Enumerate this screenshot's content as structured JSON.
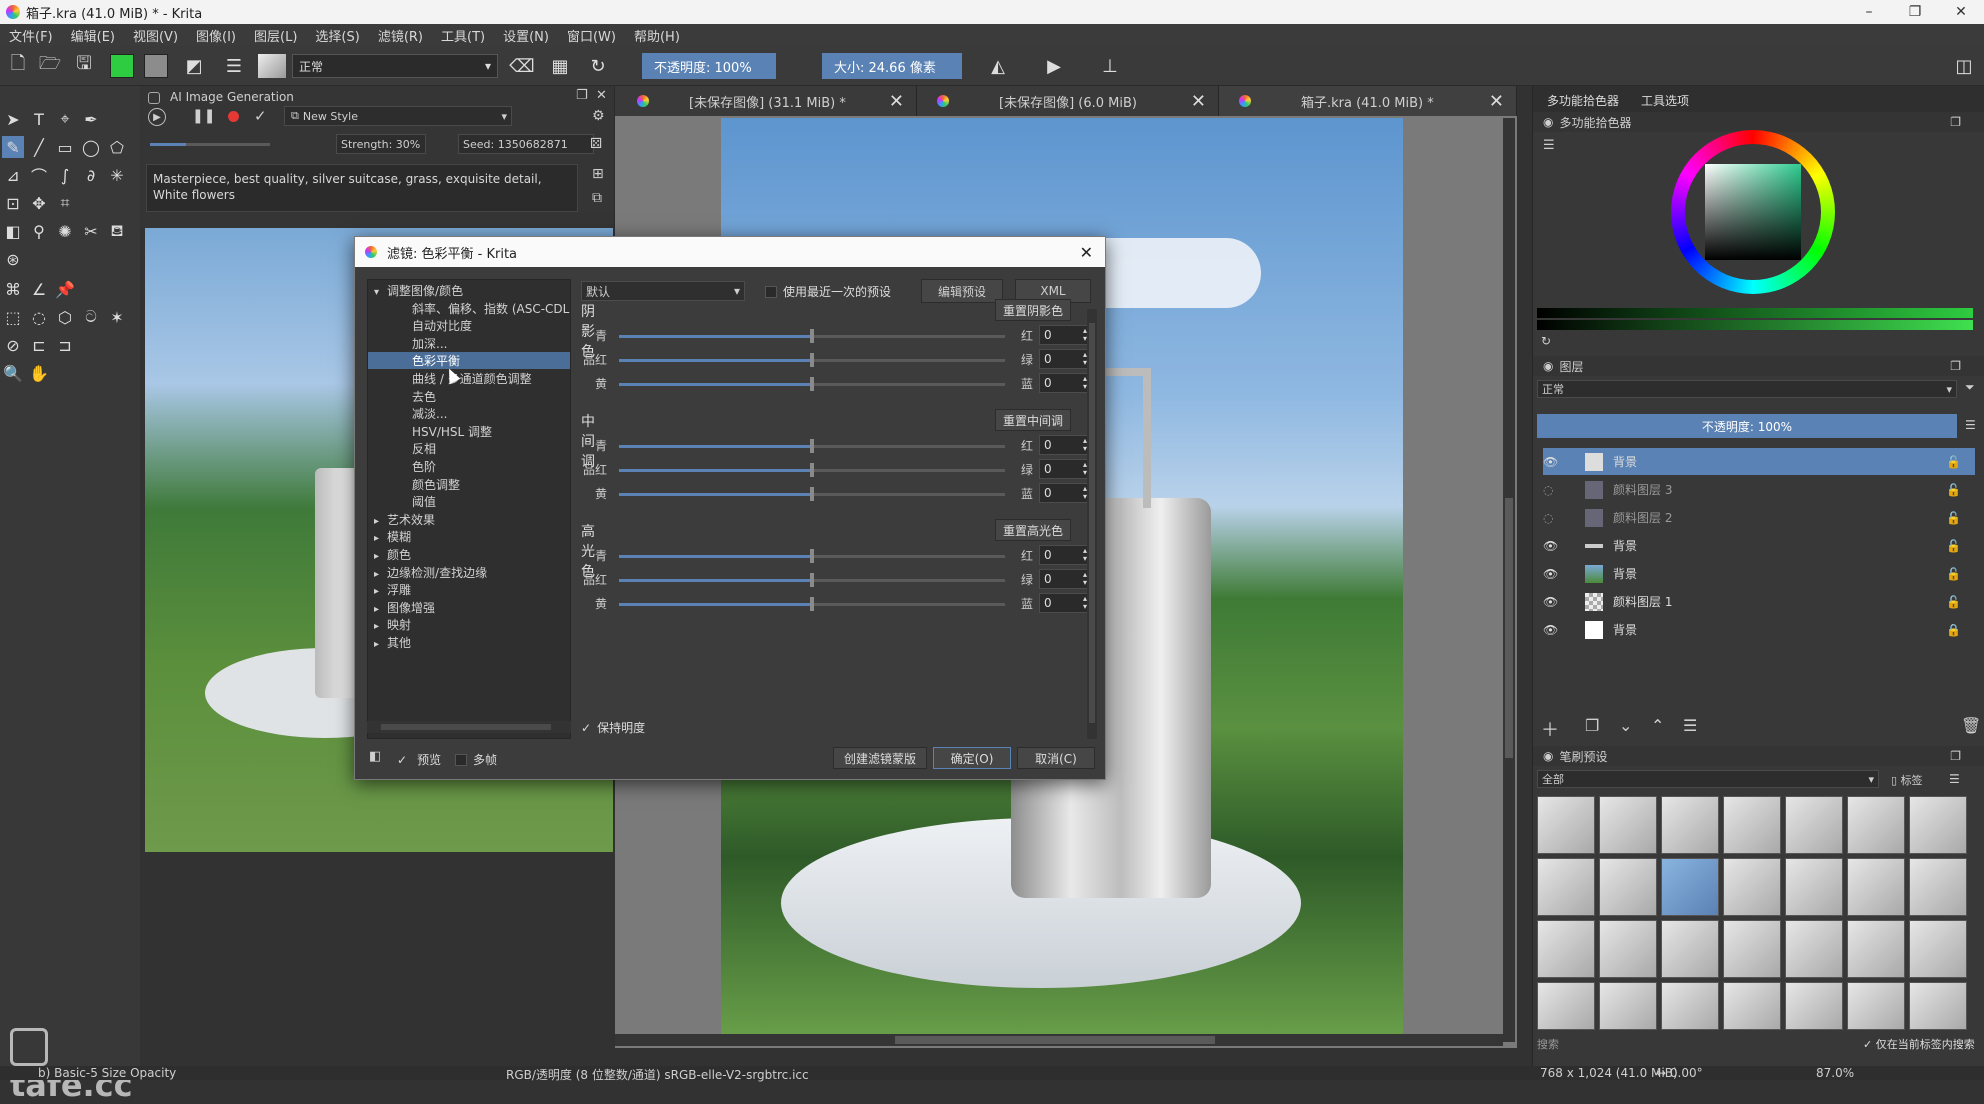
{
  "window": {
    "title": "箱子.kra (41.0 MiB) * - Krita"
  },
  "menu": [
    "文件(F)",
    "编辑(E)",
    "视图(V)",
    "图像(I)",
    "图层(L)",
    "选择(S)",
    "滤镜(R)",
    "工具(T)",
    "设置(N)",
    "窗口(W)",
    "帮助(H)"
  ],
  "toolbar": {
    "blend_mode": "正常",
    "opacity_label": "不透明度: 100%",
    "size_label": "大小: 24.66 像素"
  },
  "ai": {
    "title": "AI Image Generation",
    "style": "New Style",
    "strength": "Strength: 30%",
    "seed": "Seed: 1350682871",
    "prompt": "Masterpiece, best quality, silver suitcase, grass, exquisite detail, White flowers"
  },
  "tabs": [
    {
      "label": "[未保存图像] (31.1 MiB) *"
    },
    {
      "label": "[未保存图像] (6.0 MiB)"
    },
    {
      "label": "箱子.kra (41.0 MiB) *"
    }
  ],
  "right": {
    "tab1": "多功能拾色器",
    "tab2": "工具选项",
    "color_panel_title": "多功能拾色器",
    "layers_title": "图层",
    "layer_mode": "正常",
    "layer_opacity": "不透明度: 100%",
    "layers": [
      "背景",
      "颜料图层 3",
      "颜料图层 2",
      "背景",
      "背景",
      "颜料图层 1",
      "背景"
    ],
    "brush_title": "笔刷预设",
    "brush_filter": "全部",
    "brush_tag": "标签",
    "brush_search": "搜索",
    "brush_tag_only": "仅在当前标签内搜索"
  },
  "dialog": {
    "title": "滤镜: 色彩平衡 - Krita",
    "tree": [
      {
        "label": "调整图像/颜色",
        "level": 0,
        "expanded": true
      },
      {
        "label": "斜率、偏移、指数 (ASC-CDL)",
        "level": 1
      },
      {
        "label": "自动对比度",
        "level": 1
      },
      {
        "label": "加深...",
        "level": 1
      },
      {
        "label": "色彩平衡",
        "level": 1,
        "selected": true
      },
      {
        "label": "曲线 / 多通道颜色调整",
        "level": 1
      },
      {
        "label": "去色",
        "level": 1
      },
      {
        "label": "减淡...",
        "level": 1
      },
      {
        "label": "HSV/HSL 调整",
        "level": 1
      },
      {
        "label": "反相",
        "level": 1
      },
      {
        "label": "色阶",
        "level": 1
      },
      {
        "label": "颜色调整",
        "level": 1
      },
      {
        "label": "阈值",
        "level": 1
      },
      {
        "label": "艺术效果",
        "level": 0
      },
      {
        "label": "模糊",
        "level": 0
      },
      {
        "label": "颜色",
        "level": 0
      },
      {
        "label": "边缘检测/查找边缘",
        "level": 0
      },
      {
        "label": "浮雕",
        "level": 0
      },
      {
        "label": "图像增强",
        "level": 0
      },
      {
        "label": "映射",
        "level": 0
      },
      {
        "label": "其他",
        "level": 0
      }
    ],
    "preset": "默认",
    "use_last_preset": "使用最近一次的预设",
    "edit_preset": "编辑预设",
    "xml": "XML",
    "sections": [
      {
        "title": "阴影色",
        "reset": "重置阴影色",
        "rows": [
          {
            "left": "青",
            "right": "红",
            "value": "0"
          },
          {
            "left": "品红",
            "right": "绿",
            "value": "0"
          },
          {
            "left": "黄",
            "right": "蓝",
            "value": "0"
          }
        ]
      },
      {
        "title": "中间调",
        "reset": "重置中间调",
        "rows": [
          {
            "left": "青",
            "right": "红",
            "value": "0"
          },
          {
            "left": "品红",
            "right": "绿",
            "value": "0"
          },
          {
            "left": "黄",
            "right": "蓝",
            "value": "0"
          }
        ]
      },
      {
        "title": "高光色",
        "reset": "重置高光色",
        "rows": [
          {
            "left": "青",
            "right": "红",
            "value": "0"
          },
          {
            "left": "品红",
            "right": "绿",
            "value": "0"
          },
          {
            "left": "黄",
            "right": "蓝",
            "value": "0"
          }
        ]
      }
    ],
    "preserve_luminosity": "保持明度",
    "preview": "预览",
    "multiframe": "多帧",
    "create_mask": "创建滤镜蒙版",
    "ok": "确定(O)",
    "cancel": "取消(C)"
  },
  "status": {
    "brush": "b) Basic-5 Size Opacity",
    "colorspace": "RGB/透明度 (8 位整数/通道)  sRGB-elle-V2-srgbtrc.icc",
    "dimensions": "768 x 1,024 (41.0 MiB)",
    "rotation": "0.00°",
    "zoom": "87.0%"
  },
  "watermark": "tafe.cc",
  "colors": {
    "accent": "#5a82b4",
    "selection": "#4b6e98"
  }
}
